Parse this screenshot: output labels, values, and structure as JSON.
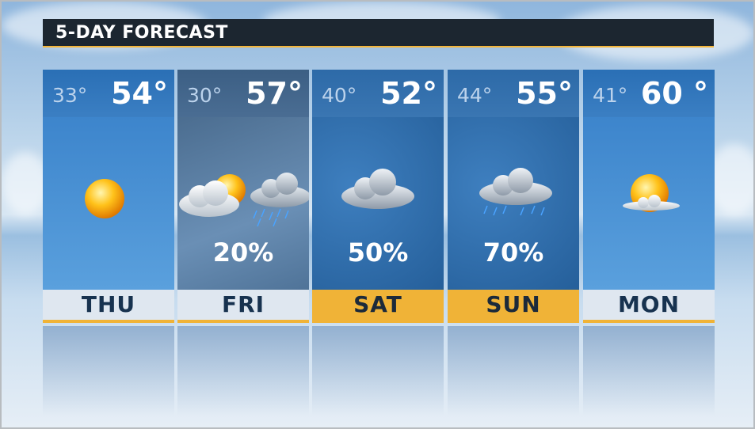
{
  "header": {
    "title": "5-DAY FORECAST"
  },
  "days": [
    {
      "day": "THU",
      "low": "33°",
      "high": "54°",
      "precip": "",
      "icon": "sunny-icon",
      "weekend": false
    },
    {
      "day": "FRI",
      "low": "30°",
      "high": "57°",
      "precip": "20%",
      "icon": "partly-cloudy-rain-icon",
      "weekend": false
    },
    {
      "day": "SAT",
      "low": "40°",
      "high": "52°",
      "precip": "50%",
      "icon": "cloudy-icon",
      "weekend": true
    },
    {
      "day": "SUN",
      "low": "44°",
      "high": "55°",
      "precip": "70%",
      "icon": "rain-cloud-icon",
      "weekend": true
    },
    {
      "day": "MON",
      "low": "41°",
      "high": "60 °",
      "precip": "",
      "icon": "mostly-sunny-icon",
      "weekend": false
    }
  ],
  "colors": {
    "accent": "#f0b337",
    "header_bg": "#1c2630",
    "day_bar": "#dfe7f0"
  }
}
